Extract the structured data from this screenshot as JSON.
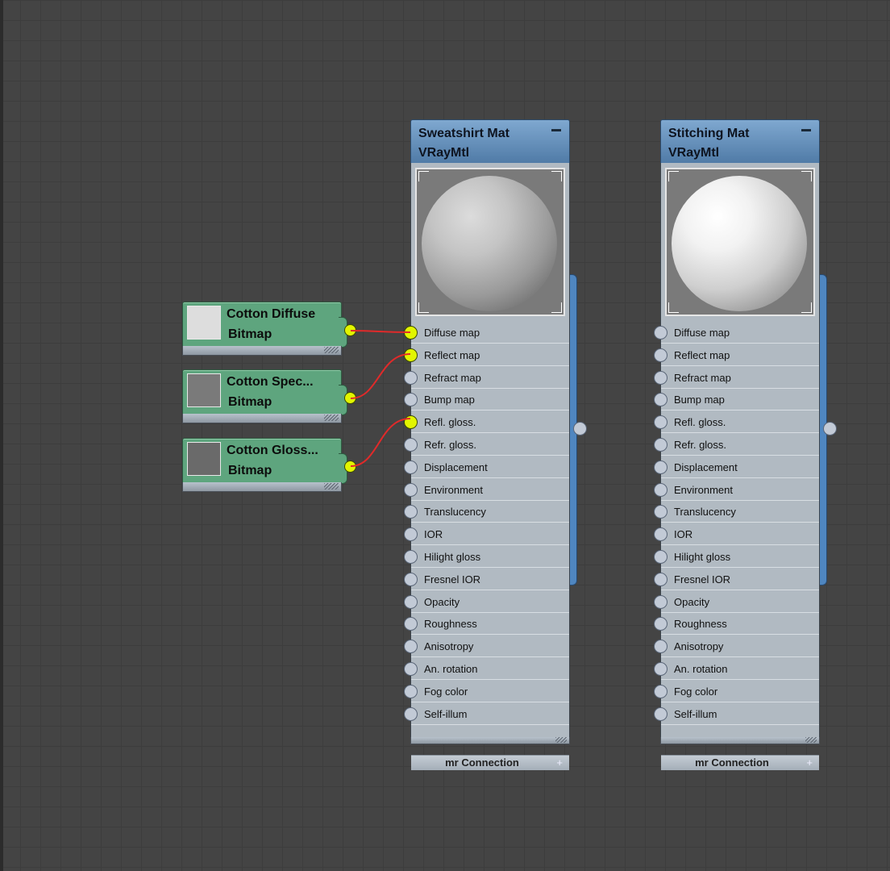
{
  "bitmap_nodes": [
    {
      "title": "Cotton Diffuse",
      "type": "Bitmap",
      "thumb_color": "#dddddd"
    },
    {
      "title": "Cotton  Spec...",
      "type": "Bitmap",
      "thumb_color": "#7a7a7a"
    },
    {
      "title": "Cotton  Gloss...",
      "type": "Bitmap",
      "thumb_color": "#6a6a6a"
    }
  ],
  "materials": [
    {
      "title": "Sweatshirt Mat",
      "type": "VRayMtl",
      "connected_slots": [
        "Diffuse map",
        "Reflect map",
        "Refl. gloss."
      ]
    },
    {
      "title": "Stitching Mat",
      "type": "VRayMtl",
      "connected_slots": []
    }
  ],
  "slots": [
    "Diffuse map",
    "Reflect map",
    "Refract map",
    "Bump map",
    "Refl. gloss.",
    "Refr. gloss.",
    "Displacement",
    "Environment",
    "Translucency",
    "IOR",
    "Hilight gloss",
    "Fresnel IOR",
    "Opacity",
    "Roughness",
    "Anisotropy",
    "An. rotation",
    "Fog color",
    "Self-illum"
  ],
  "mr_connection_label": "mr Connection",
  "colors": {
    "canvas": "#444444",
    "bitmap_node": "#5ea57e",
    "material_header": "#4f7aa6",
    "connected_socket": "#e2f500",
    "wire": "#e02a2a"
  }
}
